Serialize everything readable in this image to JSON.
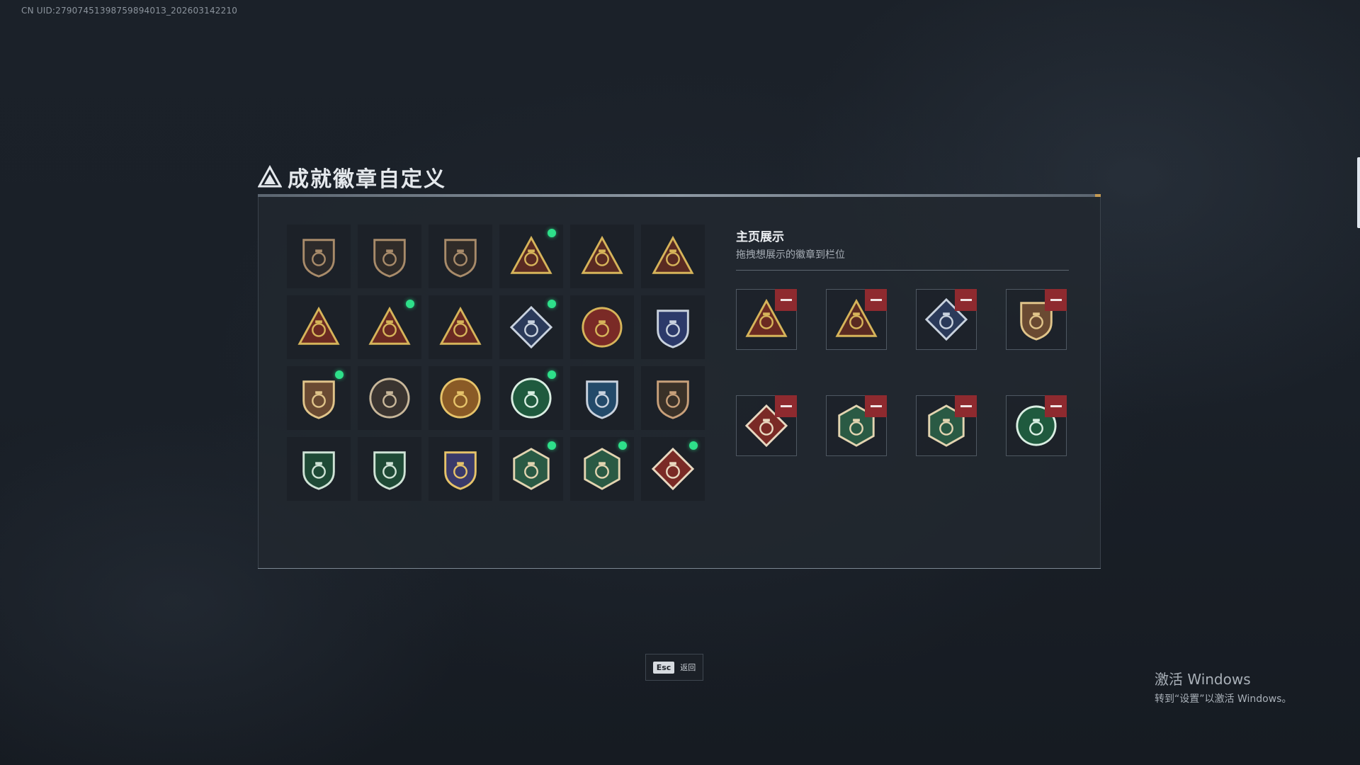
{
  "uid_text": "CN UID:2790745139875989401З_202603142210",
  "title": "成就徽章自定义",
  "side": {
    "title": "主页展示",
    "subtitle": "拖拽想展示的徽章到栏位"
  },
  "badges": [
    {
      "icon": "triangle-emblem-shield-icon",
      "shape": "shield",
      "color": "#2c2a2a",
      "accent": "#a88b6a",
      "new": false
    },
    {
      "icon": "helicopter-shield-icon",
      "shape": "shield",
      "color": "#2f2b28",
      "accent": "#a88b6a",
      "new": false
    },
    {
      "icon": "jet-shield-icon",
      "shape": "shield",
      "color": "#2f2b28",
      "accent": "#a88b6a",
      "new": false
    },
    {
      "icon": "supply-bag-55-triangle-icon",
      "shape": "triangle",
      "color": "#5a2a22",
      "accent": "#d6b45a",
      "new": true
    },
    {
      "icon": "supply-crate-triangle-icon",
      "shape": "triangle",
      "color": "#5a2a22",
      "accent": "#d6b45a",
      "new": false
    },
    {
      "icon": "cloud-triangle-icon",
      "shape": "triangle",
      "color": "#5a2a22",
      "accent": "#d6b45a",
      "new": false
    },
    {
      "icon": "number-one-triangle-icon",
      "shape": "triangle",
      "color": "#6b2a22",
      "accent": "#d6b45a",
      "new": false
    },
    {
      "icon": "supply-box-triangle-icon",
      "shape": "triangle",
      "color": "#6b2a22",
      "accent": "#d6b45a",
      "new": true
    },
    {
      "icon": "soldiers-triangle-icon",
      "shape": "triangle",
      "color": "#6b2a22",
      "accent": "#d6b45a",
      "new": false
    },
    {
      "icon": "rocket-launcher-diamond-icon",
      "shape": "diamond",
      "color": "#2b3a5a",
      "accent": "#c9d2de",
      "new": true
    },
    {
      "icon": "star-medal-circle-icon",
      "shape": "circle",
      "color": "#7a2a26",
      "accent": "#d6b45a",
      "new": false
    },
    {
      "icon": "shield-crest-blue-icon",
      "shape": "shield",
      "color": "#2c3a6a",
      "accent": "#c9d2de",
      "new": false
    },
    {
      "icon": "hex-shield-bronze-icon",
      "shape": "shield",
      "color": "#6a4a32",
      "accent": "#e0c48a",
      "new": true
    },
    {
      "icon": "soldier-portrait-circle-icon",
      "shape": "circle",
      "color": "#3a3430",
      "accent": "#c8b79a",
      "new": false
    },
    {
      "icon": "gold-emblem-laurel-icon",
      "shape": "circle",
      "color": "#8a5a26",
      "accent": "#e6c36a",
      "new": false
    },
    {
      "icon": "tank-star-green-icon",
      "shape": "circle",
      "color": "#1f5a3e",
      "accent": "#d9eee2",
      "new": true
    },
    {
      "icon": "crosshair-rifle-blue-icon",
      "shape": "shield",
      "color": "#234a6a",
      "accent": "#c9d2de",
      "new": false
    },
    {
      "icon": "rifle-shield-bronze-icon",
      "shape": "shield",
      "color": "#3a3128",
      "accent": "#c8a07a",
      "new": false
    },
    {
      "icon": "crosshair-rifle-green-shield-icon",
      "shape": "shield",
      "color": "#1f4a36",
      "accent": "#cfe3d6",
      "new": false
    },
    {
      "icon": "rifle-green-shield-icon",
      "shape": "shield",
      "color": "#1f4a36",
      "accent": "#cfe3d6",
      "new": false
    },
    {
      "icon": "crossed-guns-gold-shield-icon",
      "shape": "shield",
      "color": "#3a3a6a",
      "accent": "#e6c36a",
      "new": false
    },
    {
      "icon": "soldier-green-hex-icon",
      "shape": "hexagon",
      "color": "#2a5a44",
      "accent": "#e2d4b0",
      "new": true
    },
    {
      "icon": "shotgun-green-hex-icon",
      "shape": "hexagon",
      "color": "#2a5a44",
      "accent": "#e2d4b0",
      "new": true
    },
    {
      "icon": "runner-red-diamond-icon",
      "shape": "diamond",
      "color": "#7a2a26",
      "accent": "#e8d8c0",
      "new": true
    }
  ],
  "slots": [
    {
      "icon": "supply-box-triangle-icon",
      "shape": "triangle",
      "color": "#6b2a22",
      "accent": "#d6b45a"
    },
    {
      "icon": "supply-bag-55-triangle-icon",
      "shape": "triangle",
      "color": "#5a2a22",
      "accent": "#d6b45a"
    },
    {
      "icon": "rocket-launcher-diamond-icon",
      "shape": "diamond",
      "color": "#2b3a5a",
      "accent": "#c9d2de"
    },
    {
      "icon": "hex-shield-bronze-icon",
      "shape": "shield",
      "color": "#6a4a32",
      "accent": "#e0c48a"
    },
    {
      "icon": "runner-red-diamond-icon",
      "shape": "diamond",
      "color": "#7a2a26",
      "accent": "#e8d8c0"
    },
    {
      "icon": "soldier-green-hex-icon",
      "shape": "hexagon",
      "color": "#2a5a44",
      "accent": "#e2d4b0"
    },
    {
      "icon": "shotgun-green-hex-icon",
      "shape": "hexagon",
      "color": "#2a5a44",
      "accent": "#e2d4b0"
    },
    {
      "icon": "tank-star-green-icon",
      "shape": "circle",
      "color": "#1f5a3e",
      "accent": "#d9eee2"
    }
  ],
  "esc": {
    "key": "Esc",
    "label": "返回"
  },
  "windows": {
    "title": "激活 Windows",
    "subtitle": "转到“设置”以激活 Windows。"
  }
}
